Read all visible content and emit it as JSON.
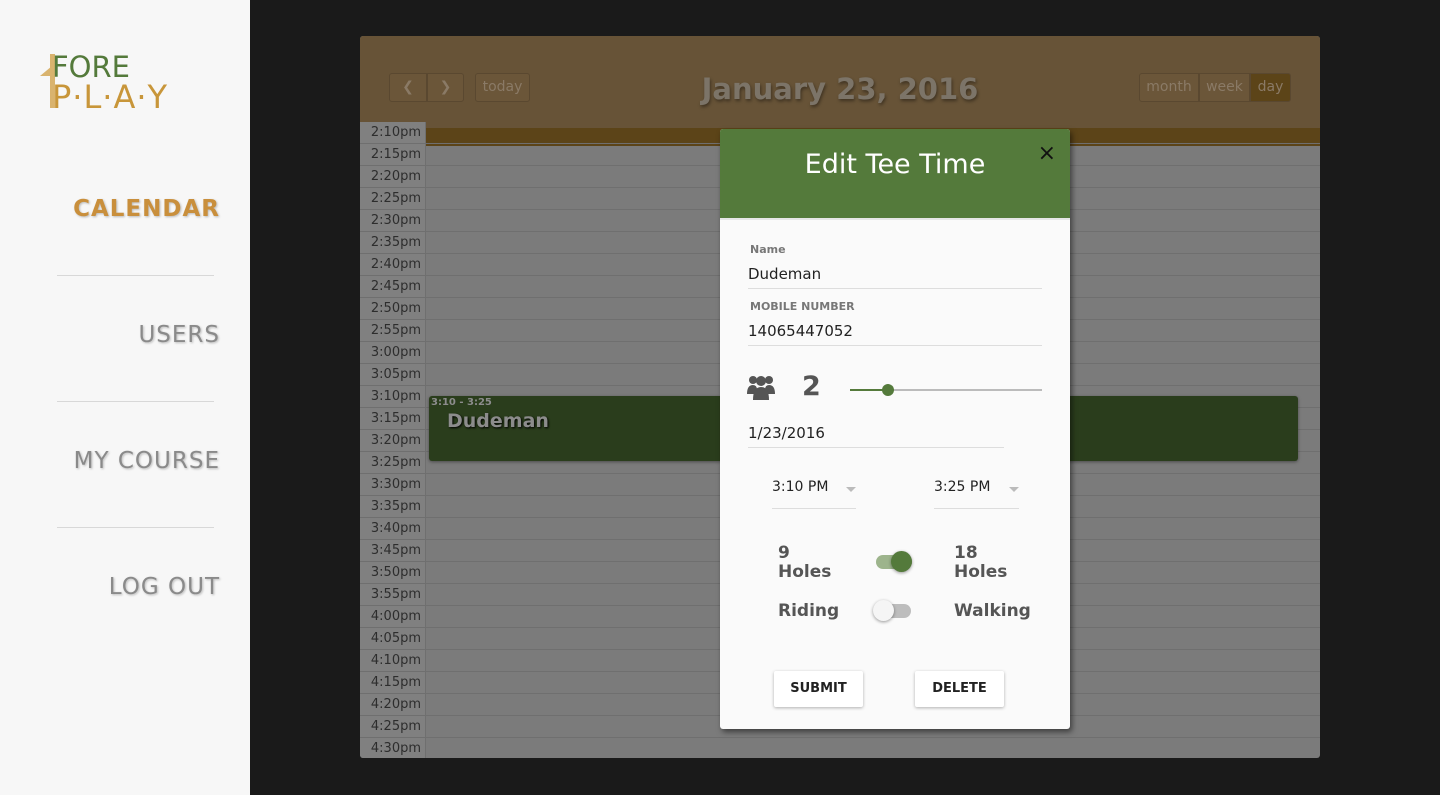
{
  "brand": {
    "logo_text_top": "FORE",
    "logo_text_bottom": "P·L·A·Y"
  },
  "sidebar": {
    "items": [
      {
        "label": "CALENDAR",
        "active": true
      },
      {
        "label": "USERS"
      },
      {
        "label": "MY COURSE"
      },
      {
        "label": "LOG OUT"
      }
    ]
  },
  "calendar": {
    "title": "January 23, 2016",
    "today_label": "today",
    "views": [
      "month",
      "week",
      "day"
    ],
    "active_view": "day",
    "times": [
      "2:10pm",
      "2:15pm",
      "2:20pm",
      "2:25pm",
      "2:30pm",
      "2:35pm",
      "2:40pm",
      "2:45pm",
      "2:50pm",
      "2:55pm",
      "3:00pm",
      "3:05pm",
      "3:10pm",
      "3:15pm",
      "3:20pm",
      "3:25pm",
      "3:30pm",
      "3:35pm",
      "3:40pm",
      "3:45pm",
      "3:50pm",
      "3:55pm",
      "4:00pm",
      "4:05pm",
      "4:10pm",
      "4:15pm",
      "4:20pm",
      "4:25pm",
      "4:30pm"
    ],
    "event": {
      "time": "3:10 - 3:25",
      "name": "Dudeman"
    }
  },
  "modal": {
    "title": "Edit Tee Time",
    "close": "×",
    "name_label": "Name",
    "name_value": "Dudeman",
    "mobile_label": "MOBILE NUMBER",
    "mobile_value": "14065447052",
    "players": "2",
    "date": "1/23/2016",
    "start_time": "3:10 PM",
    "end_time": "3:25 PM",
    "holes_left": "9 Holes",
    "holes_right": "18 Holes",
    "holes_toggle": "on",
    "ride_left": "Riding",
    "ride_right": "Walking",
    "ride_toggle": "off",
    "submit": "SUBMIT",
    "delete": "DELETE"
  },
  "colors": {
    "accent_green": "#547a3b",
    "accent_gold": "#c98f3c"
  }
}
